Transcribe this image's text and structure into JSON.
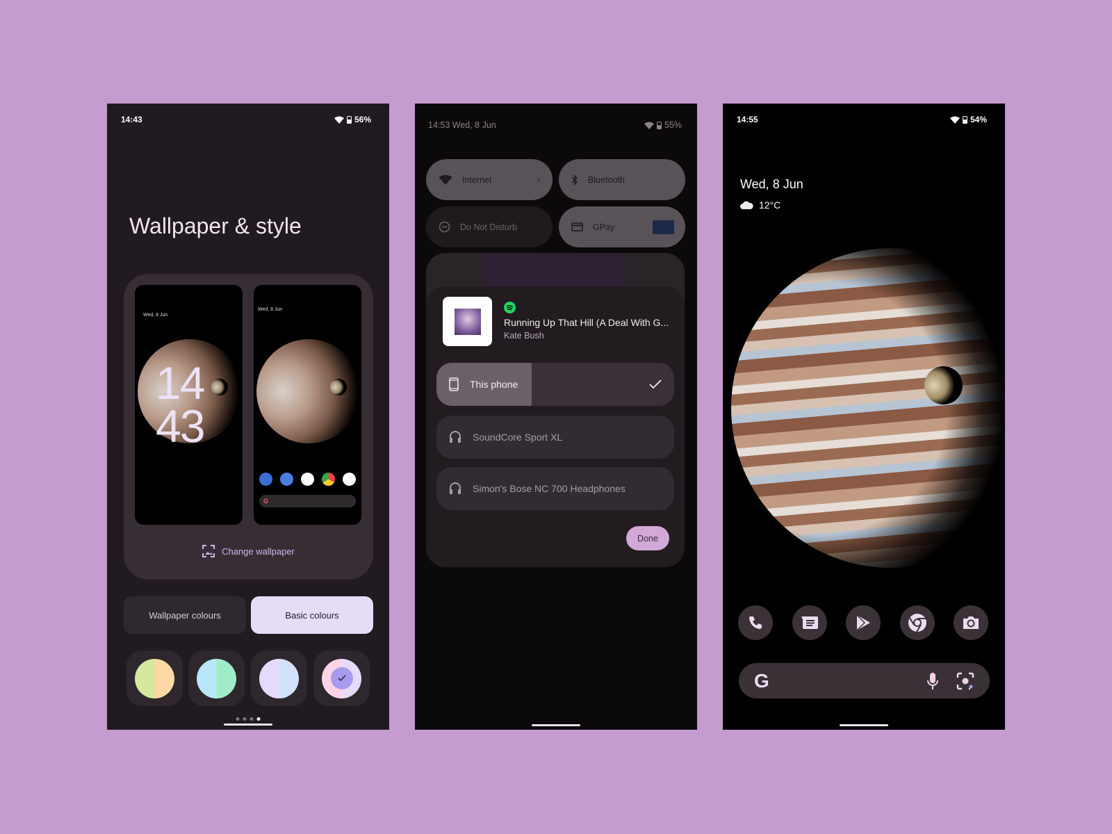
{
  "colors": {
    "background": "#c49ccf",
    "accent": "#d1a8d6",
    "selected_button": "#e5dcf8"
  },
  "phone1": {
    "status": {
      "time": "14:43",
      "battery": "56%"
    },
    "title": "Wallpaper & style",
    "lock_preview": {
      "date": "Wed, 8 Jun",
      "clock_hours": "14",
      "clock_minutes": "43"
    },
    "home_preview": {
      "date": "Wed, 8 Jun",
      "search_g": "G"
    },
    "change_wallpaper": "Change wallpaper",
    "tabs": [
      {
        "label": "Wallpaper colours",
        "selected": false
      },
      {
        "label": "Basic colours",
        "selected": true
      }
    ],
    "swatches": [
      {
        "colors": [
          "#d6e8a0",
          "#fcd9a4"
        ],
        "selected": false
      },
      {
        "colors": [
          "#b8e6fa",
          "#a0ecc8"
        ],
        "selected": false
      },
      {
        "colors": [
          "#e6dafa",
          "#d2e2fa"
        ],
        "selected": false
      },
      {
        "colors": [
          "#fcd4e6",
          "#e4dcfa"
        ],
        "selected": true
      }
    ],
    "page_indicator": {
      "count": 4,
      "active": 4
    }
  },
  "phone2": {
    "status": {
      "time_date": "14:53 Wed, 8 Jun",
      "battery": "55%"
    },
    "tiles": [
      {
        "label": "Internet",
        "icon": "wifi-icon",
        "on": true
      },
      {
        "label": "Bluetooth",
        "icon": "bluetooth-icon",
        "on": true
      },
      {
        "label": "Do Not Disturb",
        "icon": "dnd-icon",
        "on": false
      },
      {
        "label": "GPay",
        "icon": "card-icon",
        "on": true
      }
    ],
    "media": {
      "app_icon": "spotify-icon",
      "title": "Running Up That Hill (A Deal With G...",
      "artist": "Kate Bush"
    },
    "outputs": [
      {
        "label": "This phone",
        "icon": "phone-icon",
        "selected": true,
        "volume": 0.4
      },
      {
        "label": "SoundCore Sport XL",
        "icon": "headphones-icon",
        "selected": false
      },
      {
        "label": "Simon's Bose NC 700 Headphones",
        "icon": "headphones-icon",
        "selected": false
      }
    ],
    "done_label": "Done"
  },
  "phone3": {
    "status": {
      "time": "14:55",
      "battery": "54%"
    },
    "date": "Wed, 8 Jun",
    "weather": {
      "icon": "cloud-icon",
      "temp": "12°C"
    },
    "dock": [
      "phone-icon",
      "messages-icon",
      "play-store-icon",
      "chrome-icon",
      "camera-icon"
    ],
    "search": {
      "logo": "G"
    }
  }
}
